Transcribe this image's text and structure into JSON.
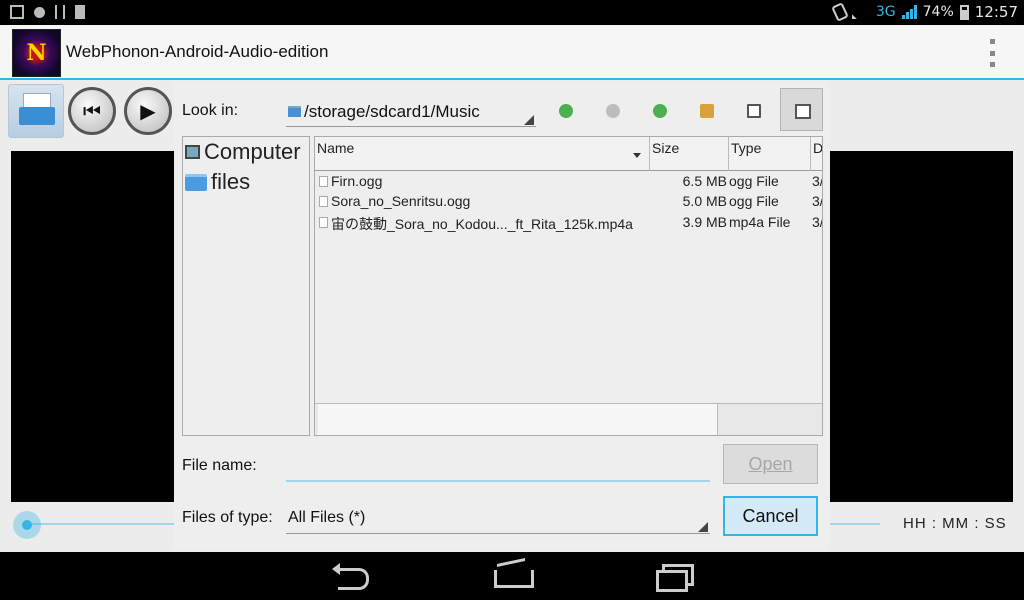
{
  "status_bar": {
    "battery_percent": "74%",
    "time": "12:57",
    "network": "3G",
    "left_icons": [
      "image-notification-icon",
      "bomb-notification-icon",
      "usb-icon",
      "sd-card-icon"
    ],
    "right_icons": [
      "rotation-lock-icon",
      "wifi-icon",
      "signal-icon",
      "battery-icon"
    ]
  },
  "action_bar": {
    "title": "WebPhonon-Android-Audio-edition",
    "logo_letter": "N"
  },
  "player": {
    "open_icon": "open-file-icon",
    "prev_glyph": "⏮",
    "play_glyph": "▶",
    "time_display": "HH : MM : SS",
    "seek_progress": 0
  },
  "dialog": {
    "look_in_label": "Look in:",
    "current_path": "/storage/sdcard1/Music",
    "toolbar_icons": [
      "back-icon",
      "forward-icon",
      "parent-dir-icon",
      "new-folder-icon",
      "list-view-icon",
      "detail-view-icon"
    ],
    "places": [
      {
        "label": "Computer",
        "icon": "computer-icon"
      },
      {
        "label": "files",
        "icon": "folder-icon"
      }
    ],
    "columns": [
      "Name",
      "Size",
      "Type",
      "D"
    ],
    "files": [
      {
        "name": "Firn.ogg",
        "size": "6.5 MB",
        "type": "ogg File",
        "date": "3/"
      },
      {
        "name": "Sora_no_Senritsu.ogg",
        "size": "5.0 MB",
        "type": "ogg File",
        "date": "3/"
      },
      {
        "name": "宙の鼓動_Sora_no_Kodou..._ft_Rita_125k.mp4a",
        "size": "3.9 MB",
        "type": "mp4a File",
        "date": "3/"
      }
    ],
    "file_name_label": "File name:",
    "file_name_value": "",
    "files_of_type_label": "Files of type:",
    "files_of_type_value": "All Files (*)",
    "open_label": "Open",
    "cancel_label": "Cancel"
  },
  "nav_bar": {
    "icons": [
      "back-nav-icon",
      "home-nav-icon",
      "recent-apps-icon"
    ]
  }
}
